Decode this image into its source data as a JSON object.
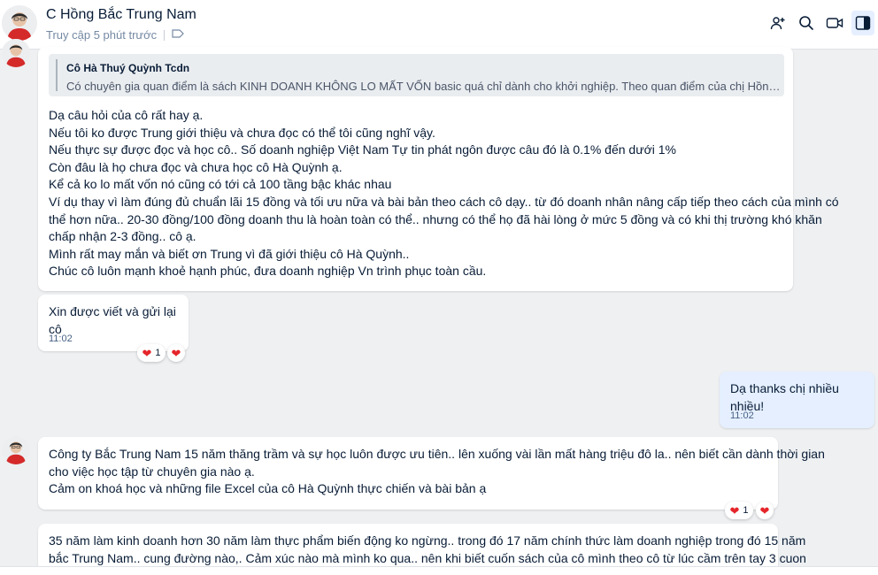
{
  "header": {
    "name": "C Hồng Bắc Trung Nam",
    "status": "Truy cập 5 phút trước"
  },
  "messages": {
    "m1": {
      "quote_name": "Cô Hà Thuý Quỳnh Tcdn",
      "quote_text": "Có chuyên gia quan điểm là sách KINH DOANH KHÔNG LO MẤT VỐN basic quá chỉ dành cho khởi nghiệp. Theo quan điểm của chị Hồng thì chị cả...",
      "lines": [
        "Dạ câu hỏi của cô rất hay ạ.",
        "Nếu tôi ko được Trung giới thiệu và chưa đọc có thể tôi cũng nghĩ vậy.",
        "Nếu thực sự được đọc và học cô.. Số doanh nghiệp Việt Nam Tự tin phát ngôn được câu đó là 0.1% đến dưới 1%",
        "Còn đâu là họ chưa đọc và chưa học cô Hà Quỳnh ạ.",
        "Kể cả ko lo mất vốn nó cũng có tới cả 100 tầng bậc khác nhau",
        "Ví dụ thay vì làm đúng đủ chuẩn lãi 15 đồng và tối ưu nữa và bài bản theo cách cô dạy.. từ đó doanh nhân nâng cấp tiếp theo cách của mình có",
        "thể hơn nữa.. 20-30 đồng/100 đồng doanh thu là hoàn toàn có thể..  nhưng có thể họ đã hài lòng ở mức 5 đồng và có khi thị trường khó khăn",
        "chấp nhận 2-3 đồng.. cô ạ.",
        "Mình rất may mắn và biết ơn Trung vì đã giới thiệu cô Hà Quỳnh..",
        "Chúc cô luôn mạnh khoẻ hạnh phúc,  đưa doanh nghiệp Vn trình phục toàn cầu."
      ]
    },
    "m2": {
      "text": "Xin được viết và gửi lại cô",
      "time": "11:02",
      "reaction_count": "1"
    },
    "m3": {
      "text": "Dạ thanks chị nhiều nhiều!",
      "time": "11:02"
    },
    "m4": {
      "lines": [
        "Công ty Bắc Trung Nam 15 năm thăng trầm và sự học luôn được ưu tiên.. lên xuống vài lần mất hàng triệu đô la.. nên biết cần dành thời gian",
        "cho việc học tập từ chuyên gia nào ạ.",
        "Cảm on khoá học và những file Excel của cô Hà Quỳnh thực chiến và bài bản ạ"
      ],
      "reaction_count": "1"
    },
    "m5": {
      "lines": [
        "35 năm làm kinh doanh hơn 30 năm làm thực phẩm biến động ko ngừng.. trong đó 17 năm chính thức làm doanh nghiệp trong đó 15 năm",
        "bắc Trung Nam.. cung đường nào,. Cảm xúc nào mà mình ko qua.. nên khi biết cuốn sách của cô mình theo cô từ lúc cầm trên tay 3 cuon"
      ]
    }
  },
  "icons": {
    "add_member": "add-member-icon",
    "search": "search-icon",
    "video": "video-call-icon",
    "panel": "sidebar-toggle-icon",
    "tag": "tag-icon",
    "reaction": "heart-icon"
  },
  "colors": {
    "accent": "#0068ff",
    "mine_bubble": "#e5efff",
    "heart": "#e5252a"
  }
}
